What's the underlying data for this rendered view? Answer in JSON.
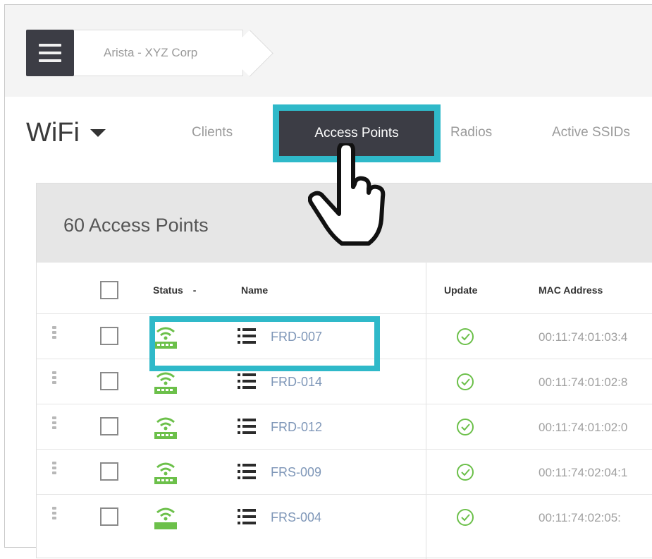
{
  "header": {
    "breadcrumb": "Arista - XYZ Corp"
  },
  "section": {
    "title": "WiFi",
    "tabs": [
      {
        "label": "Clients",
        "active": false
      },
      {
        "label": "Access Points",
        "active": true
      },
      {
        "label": "Radios",
        "active": false
      },
      {
        "label": "Active SSIDs",
        "active": false
      }
    ]
  },
  "panel": {
    "title": "60 Access Points",
    "columns": {
      "status": "Status",
      "status_sort": "-",
      "name": "Name",
      "update": "Update",
      "mac": "MAC Address"
    },
    "rows": [
      {
        "name": "FRD-007",
        "mac": "00:11:74:01:03:4"
      },
      {
        "name": "FRD-014",
        "mac": "00:11:74:01:02:8"
      },
      {
        "name": "FRD-012",
        "mac": "00:11:74:01:02:0"
      },
      {
        "name": "FRS-009",
        "mac": "00:11:74:02:04:1"
      },
      {
        "name": "FRS-004",
        "mac": "00:11:74:02:05:"
      }
    ]
  },
  "colors": {
    "accent_highlight": "#2fb9c9",
    "dark_button": "#3c3d45",
    "status_green": "#6cc04a",
    "link_blue": "#7f97b8"
  }
}
